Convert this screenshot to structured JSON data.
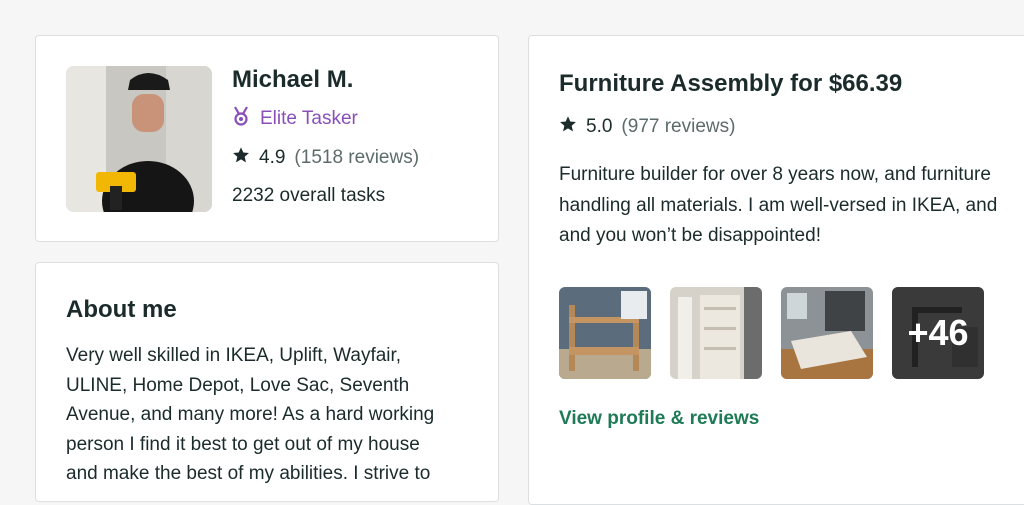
{
  "colors": {
    "page_bg": "#f6f6f7",
    "elite_purple": "#8a4fb7",
    "link_green": "#1f7a56",
    "star_dark": "#1b2b2b"
  },
  "profile": {
    "name": "Michael M.",
    "badge": "Elite Tasker",
    "badge_icon": "elite-medal-icon",
    "rating": "4.9",
    "reviews": "(1518 reviews)",
    "tasks": "2232 overall tasks",
    "avatar_icon": "tasker-photo"
  },
  "about": {
    "title": "About me",
    "lines": [
      "Very well skilled in IKEA, Uplift, Wayfair,",
      "ULINE, Home Depot, Love Sac, Seventh",
      "Avenue, and many more! As a hard working",
      "person I find it best to get out of my house",
      "and make the best of my abilities. I strive to"
    ]
  },
  "service": {
    "title": "Furniture Assembly for $66.39",
    "rating": "5.0",
    "reviews": "(977 reviews)",
    "description_lines": [
      "Furniture builder for over 8 years now, and furniture",
      "handling all materials. I am well-versed in IKEA, and",
      "and you won’t be disappointed!"
    ],
    "more_photos": "+46",
    "view_link": "View profile & reviews"
  }
}
